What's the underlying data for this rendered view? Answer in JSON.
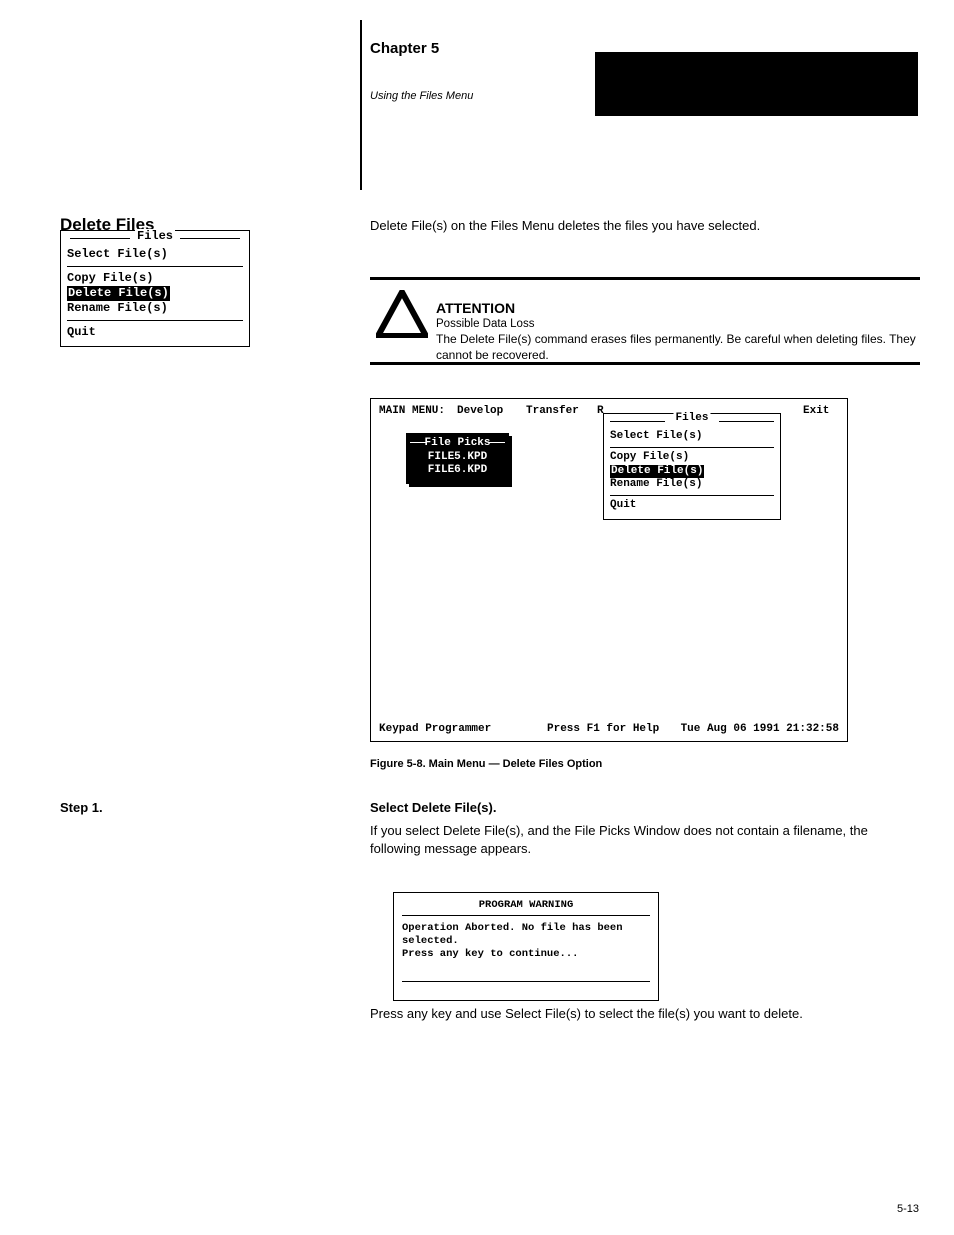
{
  "header": {
    "chapter_number": "Chapter 5",
    "chapter_pre": "Using the Files Menu",
    "chapter_title": ""
  },
  "section": {
    "title": "Delete Files",
    "intro": "Delete File(s) on the Files Menu deletes the files you have selected."
  },
  "mini_files_menu": {
    "title": "Files",
    "items": [
      "Select File(s)",
      "Copy File(s)",
      "Delete File(s)",
      "Rename File(s)",
      "Quit"
    ],
    "highlighted_index": 2
  },
  "attention": {
    "label": "ATTENTION",
    "subtitle": "Possible Data Loss",
    "body": "The Delete File(s) command erases files permanently. Be careful when deleting files. They cannot be recovered."
  },
  "screen": {
    "menubar": {
      "main_label": "MAIN MENU:",
      "items": [
        "Develop",
        "Transfer",
        "R",
        "Exit"
      ]
    },
    "file_picks": {
      "title": "File Picks",
      "items": [
        "FILE5.KPD",
        "FILE6.KPD"
      ]
    },
    "files_menu": {
      "title": "Files",
      "items": [
        "Select File(s)",
        "Copy File(s)",
        "Delete File(s)",
        "Rename File(s)",
        "Quit"
      ],
      "highlighted_index": 2
    },
    "statusbar": {
      "app": "Keypad Programmer",
      "help": "Press F1 for Help",
      "datetime": "Tue Aug 06 1991 21:32:58"
    }
  },
  "figure_caption": "Figure 5-8.  Main Menu — Delete Files Option",
  "step": {
    "label": "Step 1.",
    "heading": "Select Delete File(s).",
    "note": "If you select Delete File(s), and the File Picks Window does not contain a filename, the following message appears."
  },
  "warning": {
    "title": "PROGRAM WARNING",
    "line1": "Operation Aborted.  No file has been selected.",
    "line2": "Press any key to continue..."
  },
  "after_warning": "Press any key and use Select File(s) to select the file(s) you want to delete.",
  "page_number": "5-13"
}
